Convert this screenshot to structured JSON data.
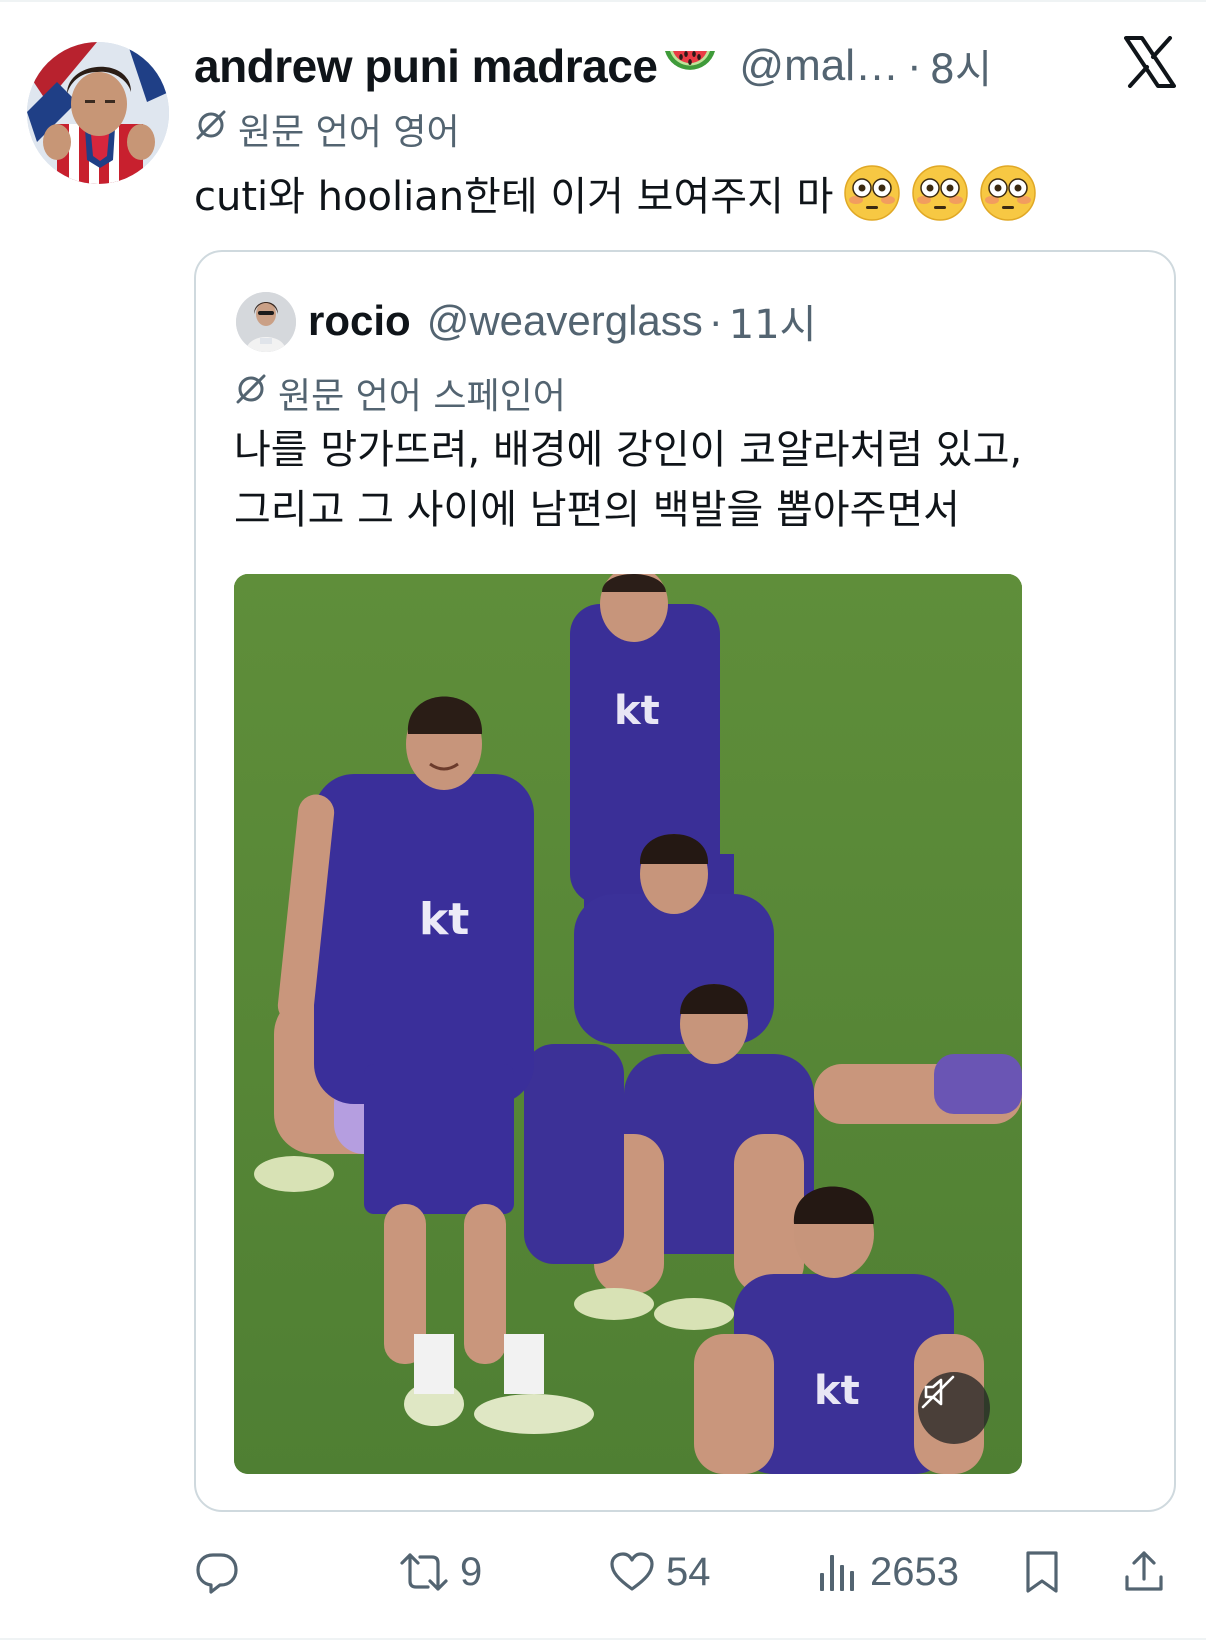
{
  "colors": {
    "text": "#0f1419",
    "secondary": "#536471",
    "border": "#cfd9de",
    "background": "#ffffff"
  },
  "tweet": {
    "display_name": "andrew puni madrace",
    "name_emoji": "watermelon-emoji",
    "handle": "@mal…",
    "separator": "·",
    "time": "8시",
    "translation_note": "원문 언어 영어",
    "text": "cuti와 hoolian한테 이거 보여주지 마",
    "trailing_emoji": [
      "flushed-face-emoji",
      "flushed-face-emoji",
      "flushed-face-emoji"
    ]
  },
  "quote": {
    "display_name": "rocio",
    "handle": "@weaverglass",
    "separator": "·",
    "time": "11시",
    "translation_note": "원문 언어 스페인어",
    "text_lines": [
      "나를 망가뜨려, 배경에 강인이 코알라처럼 있고,",
      "그리고 그 사이에 남편의 백발을 뽑아주면서"
    ],
    "media": {
      "type": "video",
      "muted": true,
      "jersey_text": "kt"
    }
  },
  "actions": {
    "reply": {
      "icon": "reply-icon",
      "count": ""
    },
    "retweet": {
      "icon": "retweet-icon",
      "count": "9"
    },
    "like": {
      "icon": "heart-icon",
      "count": "54"
    },
    "views": {
      "icon": "views-chart-icon",
      "count": "2653"
    },
    "bookmark": {
      "icon": "bookmark-icon"
    },
    "share": {
      "icon": "share-icon"
    }
  },
  "brand": {
    "icon": "x-logo-icon"
  }
}
